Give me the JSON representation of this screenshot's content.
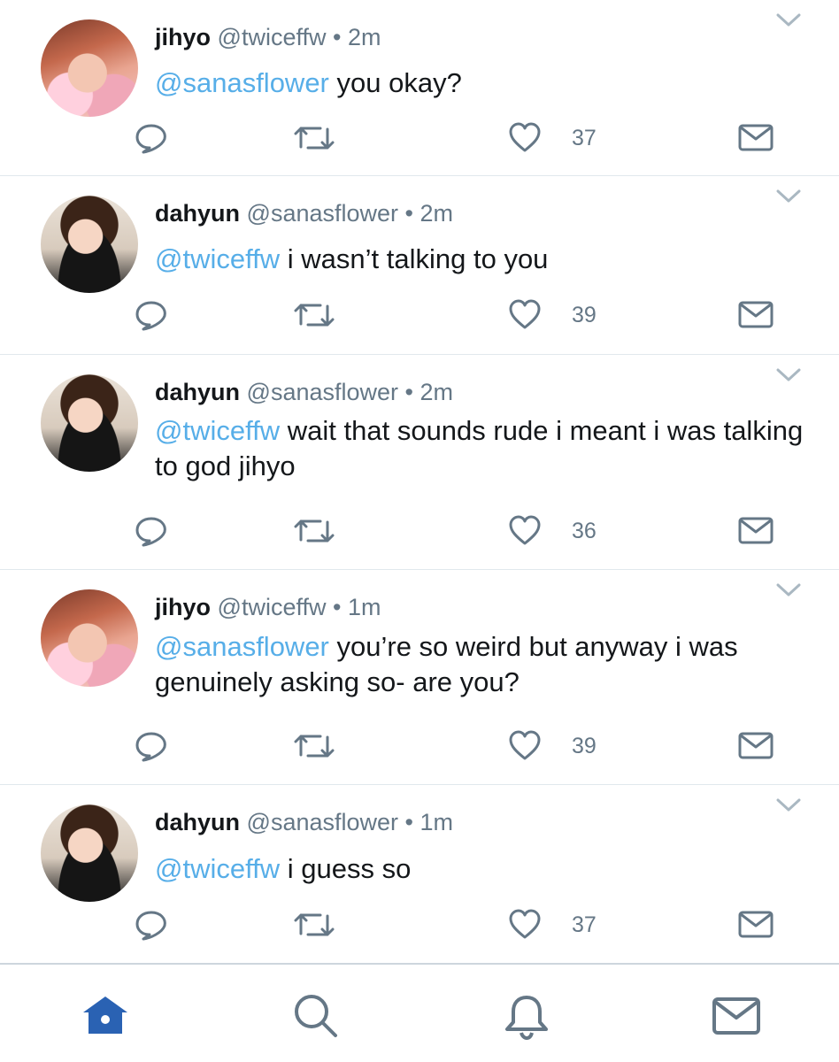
{
  "colors": {
    "accent": "#1da1f2",
    "mention": "#57aee8",
    "muted": "#657786",
    "active_tab": "#2a62b3"
  },
  "tweets": [
    {
      "author": "jihyo",
      "handle": "@twiceffw",
      "dot": "•",
      "time": "2m",
      "avatar": "jihyo",
      "mention": "@sanasflower",
      "text": " you okay?",
      "likes": "37"
    },
    {
      "author": "dahyun",
      "handle": "@sanasflower",
      "dot": "•",
      "time": "2m",
      "avatar": "dahyun",
      "mention": "@twiceffw",
      "text": " i wasn’t talking to you",
      "likes": "39"
    },
    {
      "author": "dahyun",
      "handle": "@sanasflower",
      "dot": "•",
      "time": "2m",
      "avatar": "dahyun",
      "mention": "@twiceffw",
      "text": " wait that sounds rude i meant i was talking to god jihyo",
      "likes": "36"
    },
    {
      "author": "jihyo",
      "handle": "@twiceffw",
      "dot": "•",
      "time": "1m",
      "avatar": "jihyo",
      "mention": "@sanasflower",
      "text": " you’re so weird but anyway i was genuinely asking so- are you?",
      "likes": "39"
    },
    {
      "author": "dahyun",
      "handle": "@sanasflower",
      "dot": "•",
      "time": "1m",
      "avatar": "dahyun",
      "mention": "@twiceffw",
      "text": " i guess so",
      "likes": "37"
    }
  ],
  "actions": [
    "reply-icon",
    "retweet-icon",
    "like-icon",
    "direct-message-icon"
  ],
  "tabbar": {
    "tabs": [
      {
        "icon": "home-icon",
        "active": true
      },
      {
        "icon": "search-icon",
        "active": false
      },
      {
        "icon": "notifications-bell-icon",
        "active": false
      },
      {
        "icon": "messages-envelope-icon",
        "active": false
      }
    ]
  }
}
